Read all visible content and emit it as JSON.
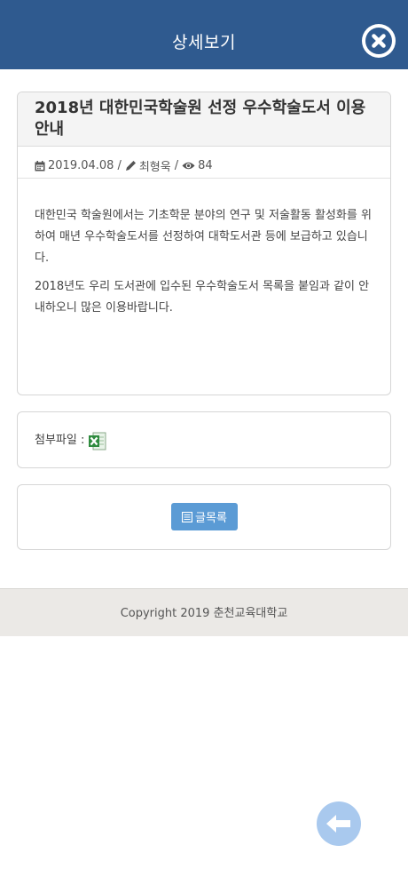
{
  "header": {
    "title": "상세보기",
    "close_icon": "close-circle-icon"
  },
  "article": {
    "title": "2018년 대한민국학술원 선정 우수학술도서 이용안내",
    "date": "2019.04.08",
    "author": "최형욱",
    "views": "84",
    "paragraphs": [
      "대한민국 학술원에서는 기초학문 분야의 연구 및 저술활동 활성화를 위하여 매년 우수학술도서를 선정하여 대학도서관 등에 보급하고 있습니다.",
      "2018년도 우리 도서관에 입수된 우수학술도서 목록을 붙임과 같이 안내하오니 많은 이용바랍니다."
    ]
  },
  "attachment": {
    "label": "첨부파일 :",
    "icon": "excel-file-icon"
  },
  "actions": {
    "list_label": "글목록"
  },
  "footer": {
    "copyright": "Copyright 2019 춘천교육대학교"
  },
  "colors": {
    "header_bg": "#2f5a8f",
    "button_bg": "#5b9bd5",
    "back_button_bg": "#a9c9ee",
    "footer_bg": "#ebe9e6"
  }
}
